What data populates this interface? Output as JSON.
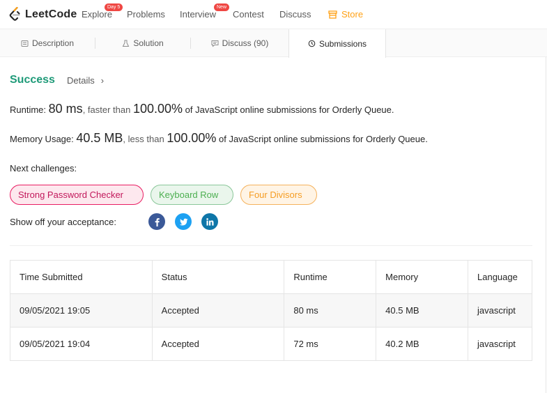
{
  "nav": {
    "logo_text": "LeetCode",
    "items": [
      {
        "label": "Explore",
        "badge": "Day 5"
      },
      {
        "label": "Problems"
      },
      {
        "label": "Interview",
        "badge": "New"
      },
      {
        "label": "Contest"
      },
      {
        "label": "Discuss"
      },
      {
        "label": "Store"
      }
    ],
    "store_color": "#ffa116"
  },
  "tabs": [
    {
      "label": "Description",
      "icon": "document-icon"
    },
    {
      "label": "Solution",
      "icon": "flask-icon"
    },
    {
      "label": "Discuss (90)",
      "icon": "comment-icon"
    },
    {
      "label": "Submissions",
      "icon": "clock-icon",
      "active": true
    }
  ],
  "result": {
    "status": "Success",
    "details_label": "Details",
    "runtime_label": "Runtime:",
    "runtime_value": "80 ms",
    "runtime_mid": ", faster than",
    "runtime_pct": "100.00%",
    "runtime_tail": " of JavaScript online submissions for Orderly Queue.",
    "memory_label": "Memory Usage:",
    "memory_value": "40.5 MB",
    "memory_mid": ", less than",
    "memory_pct": "100.00%",
    "memory_tail": " of JavaScript online submissions for Orderly Queue.",
    "status_color": "#1e9a78"
  },
  "next": {
    "label": "Next challenges:",
    "challenges": [
      "Strong Password Checker",
      "Keyboard Row",
      "Four Divisors"
    ]
  },
  "share": {
    "label": "Show off your acceptance:",
    "networks": [
      "facebook-icon",
      "twitter-icon",
      "linkedin-icon"
    ]
  },
  "table": {
    "headers": [
      "Time Submitted",
      "Status",
      "Runtime",
      "Memory",
      "Language"
    ],
    "rows": [
      [
        "09/05/2021 19:05",
        "Accepted",
        "80 ms",
        "40.5 MB",
        "javascript"
      ],
      [
        "09/05/2021 19:04",
        "Accepted",
        "72 ms",
        "40.2 MB",
        "javascript"
      ]
    ]
  }
}
